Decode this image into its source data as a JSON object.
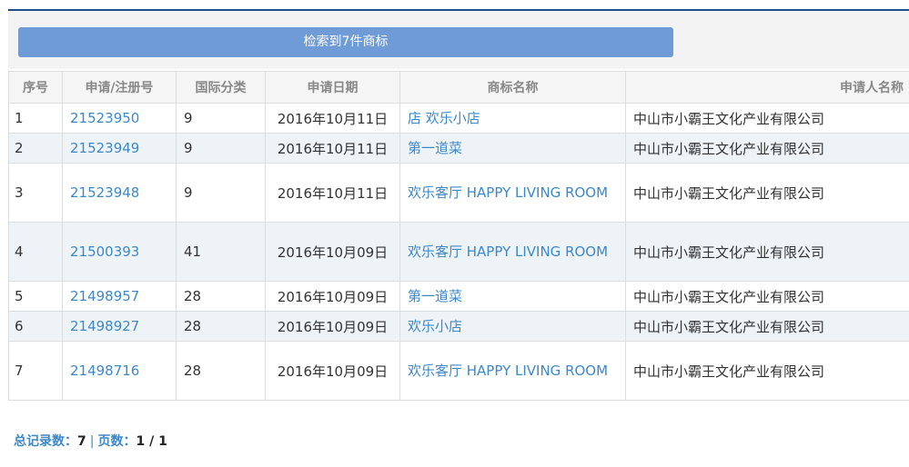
{
  "search": {
    "result_label": "检索到7件商标"
  },
  "table": {
    "headers": {
      "index": "序号",
      "reg_no": "申请/注册号",
      "class": "国际分类",
      "date": "申请日期",
      "name": "商标名称",
      "applicant": "申请人名称"
    },
    "rows": [
      {
        "index": "1",
        "reg_no": "21523950",
        "class": "9",
        "date": "2016年10月11日",
        "name": "店 欢乐小店",
        "applicant": "中山市小霸王文化产业有限公司"
      },
      {
        "index": "2",
        "reg_no": "21523949",
        "class": "9",
        "date": "2016年10月11日",
        "name": "第一道菜",
        "applicant": "中山市小霸王文化产业有限公司"
      },
      {
        "index": "3",
        "reg_no": "21523948",
        "class": "9",
        "date": "2016年10月11日",
        "name": "欢乐客厅 HAPPY LIVING ROOM",
        "applicant": "中山市小霸王文化产业有限公司"
      },
      {
        "index": "4",
        "reg_no": "21500393",
        "class": "41",
        "date": "2016年10月09日",
        "name": "欢乐客厅 HAPPY LIVING ROOM",
        "applicant": "中山市小霸王文化产业有限公司"
      },
      {
        "index": "5",
        "reg_no": "21498957",
        "class": "28",
        "date": "2016年10月09日",
        "name": "第一道菜",
        "applicant": "中山市小霸王文化产业有限公司"
      },
      {
        "index": "6",
        "reg_no": "21498927",
        "class": "28",
        "date": "2016年10月09日",
        "name": "欢乐小店",
        "applicant": "中山市小霸王文化产业有限公司"
      },
      {
        "index": "7",
        "reg_no": "21498716",
        "class": "28",
        "date": "2016年10月09日",
        "name": "欢乐客厅 HAPPY LIVING ROOM",
        "applicant": "中山市小霸王文化产业有限公司"
      }
    ]
  },
  "footer": {
    "total_label": "总记录数：",
    "total_value": "7",
    "separator": "|",
    "pages_label": "页数：",
    "pages_value": "1 / 1"
  },
  "colors": {
    "accent": "#6f9bd6",
    "link": "#3c88c9",
    "top_line": "#1f4e8c",
    "row_alt": "#eef3f8"
  }
}
